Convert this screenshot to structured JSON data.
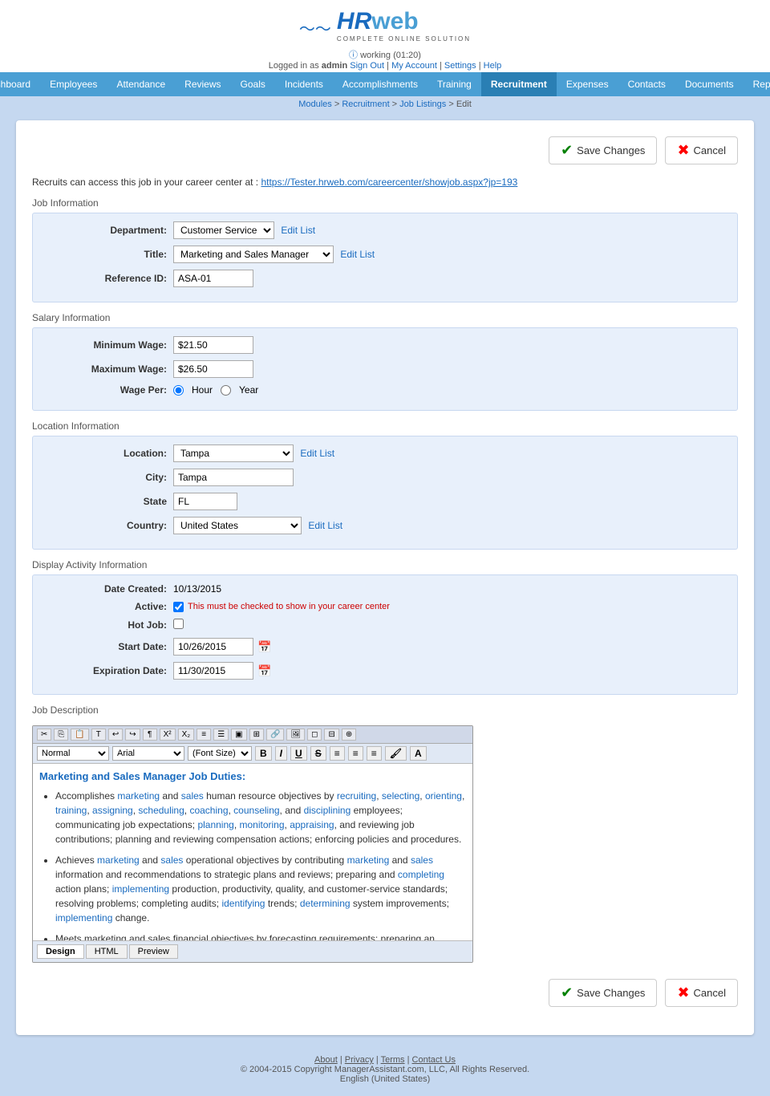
{
  "header": {
    "logo_hr": "HR",
    "logo_web": "web",
    "logo_subtitle": "COMPLETE  ONLINE  SOLUTION",
    "working_text": "working (01:20)",
    "logged_in_text": "Logged in as",
    "admin": "admin",
    "sign_out": "Sign Out",
    "my_account": "My Account",
    "settings": "Settings",
    "help": "Help"
  },
  "nav": {
    "items": [
      {
        "label": "Dashboard",
        "active": false
      },
      {
        "label": "Employees",
        "active": false
      },
      {
        "label": "Attendance",
        "active": false
      },
      {
        "label": "Reviews",
        "active": false
      },
      {
        "label": "Goals",
        "active": false
      },
      {
        "label": "Incidents",
        "active": false
      },
      {
        "label": "Accomplishments",
        "active": false
      },
      {
        "label": "Training",
        "active": false
      },
      {
        "label": "Recruitment",
        "active": true
      },
      {
        "label": "Expenses",
        "active": false
      },
      {
        "label": "Contacts",
        "active": false
      },
      {
        "label": "Documents",
        "active": false
      },
      {
        "label": "Reports",
        "active": false
      }
    ]
  },
  "breadcrumb": {
    "items": [
      "Modules",
      "Recruitment",
      "Job Listings",
      "Edit"
    ]
  },
  "actions": {
    "save_label": "Save Changes",
    "cancel_label": "Cancel"
  },
  "career_link": {
    "prefix": "Recruits can access this job in your career center at :",
    "url": "https://Tester.hrweb.com/careercenter/showjob.aspx?jp=193"
  },
  "job_info": {
    "section_label": "Job Information",
    "department_label": "Department:",
    "department_value": "Customer Service",
    "edit_list_dept": "Edit List",
    "title_label": "Title:",
    "title_value": "Marketing and Sales Manager",
    "edit_list_title": "Edit List",
    "ref_id_label": "Reference ID:",
    "ref_id_value": "ASA-01"
  },
  "salary_info": {
    "section_label": "Salary Information",
    "min_wage_label": "Minimum Wage:",
    "min_wage_value": "$21.50",
    "max_wage_label": "Maximum Wage:",
    "max_wage_value": "$26.50",
    "wage_per_label": "Wage Per:",
    "wage_per_hour": "Hour",
    "wage_per_year": "Year"
  },
  "location_info": {
    "section_label": "Location Information",
    "location_label": "Location:",
    "location_value": "Tampa",
    "edit_list_location": "Edit List",
    "city_label": "City:",
    "city_value": "Tampa",
    "state_label": "State",
    "state_value": "FL",
    "country_label": "Country:",
    "country_value": "United States",
    "edit_list_country": "Edit List"
  },
  "display_activity": {
    "section_label": "Display Activity Information",
    "date_created_label": "Date Created:",
    "date_created_value": "10/13/2015",
    "active_label": "Active:",
    "active_note": "This must be checked to show in your career center",
    "hot_job_label": "Hot Job:",
    "start_date_label": "Start Date:",
    "start_date_value": "10/26/2015",
    "expiration_date_label": "Expiration Date:",
    "expiration_date_value": "11/30/2015"
  },
  "job_description": {
    "section_label": "Job Description",
    "format_style": "Normal",
    "format_font": "Arial",
    "format_size": "(Font Size)",
    "editor_tabs": [
      "Design",
      "HTML",
      "Preview"
    ],
    "active_tab": "Design",
    "title": "Marketing and Sales Manager Job Duties:",
    "paragraphs": [
      "Accomplishes marketing and sales human resource objectives by recruiting, selecting, orienting, training, assigning, scheduling, coaching, counseling, and disciplining employees; communicating job expectations; planning, monitoring, appraising, and reviewing job contributions; planning and reviewing compensation actions; enforcing policies and procedures.",
      "Achieves marketing and sales operational objectives by contributing marketing and sales information and recommendations to strategic plans and reviews; preparing and completing action plans; implementing production, productivity, quality, and customer-service standards; resolving problems; completing audits; identifying trends; determining system improvements; implementing change.",
      "Meets marketing and sales financial objectives by forecasting requirements; preparing an..."
    ],
    "highlighted_words": [
      "marketing",
      "sales",
      "recruiting",
      "selecting",
      "orienting",
      "training",
      "assigning",
      "scheduling",
      "coaching",
      "counseling",
      "disciplining",
      "planning",
      "monitoring",
      "appraising",
      "reviewing",
      "marketing",
      "sales",
      "implementing",
      "completing",
      "identifying",
      "determining",
      "implementing"
    ]
  },
  "footer": {
    "about": "About",
    "privacy": "Privacy",
    "terms": "Terms",
    "contact_us": "Contact Us",
    "copyright": "© 2004-2015 Copyright ManagerAssistant.com, LLC, All Rights Reserved.",
    "language": "English (United States)"
  }
}
